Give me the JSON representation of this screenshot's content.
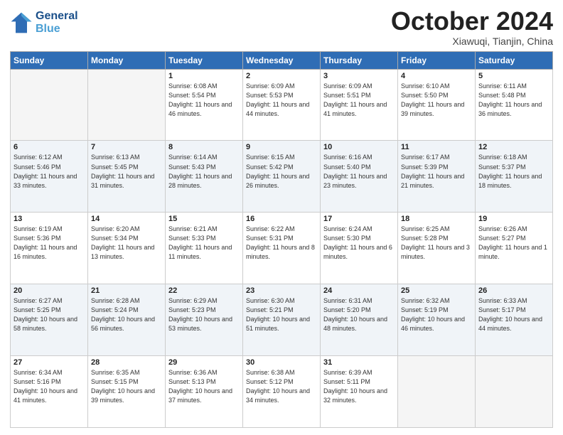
{
  "header": {
    "logo_line1": "General",
    "logo_line2": "Blue",
    "month": "October 2024",
    "location": "Xiawuqi, Tianjin, China"
  },
  "weekdays": [
    "Sunday",
    "Monday",
    "Tuesday",
    "Wednesday",
    "Thursday",
    "Friday",
    "Saturday"
  ],
  "weeks": [
    [
      {
        "day": "",
        "info": ""
      },
      {
        "day": "",
        "info": ""
      },
      {
        "day": "1",
        "info": "Sunrise: 6:08 AM\nSunset: 5:54 PM\nDaylight: 11 hours and 46 minutes."
      },
      {
        "day": "2",
        "info": "Sunrise: 6:09 AM\nSunset: 5:53 PM\nDaylight: 11 hours and 44 minutes."
      },
      {
        "day": "3",
        "info": "Sunrise: 6:09 AM\nSunset: 5:51 PM\nDaylight: 11 hours and 41 minutes."
      },
      {
        "day": "4",
        "info": "Sunrise: 6:10 AM\nSunset: 5:50 PM\nDaylight: 11 hours and 39 minutes."
      },
      {
        "day": "5",
        "info": "Sunrise: 6:11 AM\nSunset: 5:48 PM\nDaylight: 11 hours and 36 minutes."
      }
    ],
    [
      {
        "day": "6",
        "info": "Sunrise: 6:12 AM\nSunset: 5:46 PM\nDaylight: 11 hours and 33 minutes."
      },
      {
        "day": "7",
        "info": "Sunrise: 6:13 AM\nSunset: 5:45 PM\nDaylight: 11 hours and 31 minutes."
      },
      {
        "day": "8",
        "info": "Sunrise: 6:14 AM\nSunset: 5:43 PM\nDaylight: 11 hours and 28 minutes."
      },
      {
        "day": "9",
        "info": "Sunrise: 6:15 AM\nSunset: 5:42 PM\nDaylight: 11 hours and 26 minutes."
      },
      {
        "day": "10",
        "info": "Sunrise: 6:16 AM\nSunset: 5:40 PM\nDaylight: 11 hours and 23 minutes."
      },
      {
        "day": "11",
        "info": "Sunrise: 6:17 AM\nSunset: 5:39 PM\nDaylight: 11 hours and 21 minutes."
      },
      {
        "day": "12",
        "info": "Sunrise: 6:18 AM\nSunset: 5:37 PM\nDaylight: 11 hours and 18 minutes."
      }
    ],
    [
      {
        "day": "13",
        "info": "Sunrise: 6:19 AM\nSunset: 5:36 PM\nDaylight: 11 hours and 16 minutes."
      },
      {
        "day": "14",
        "info": "Sunrise: 6:20 AM\nSunset: 5:34 PM\nDaylight: 11 hours and 13 minutes."
      },
      {
        "day": "15",
        "info": "Sunrise: 6:21 AM\nSunset: 5:33 PM\nDaylight: 11 hours and 11 minutes."
      },
      {
        "day": "16",
        "info": "Sunrise: 6:22 AM\nSunset: 5:31 PM\nDaylight: 11 hours and 8 minutes."
      },
      {
        "day": "17",
        "info": "Sunrise: 6:24 AM\nSunset: 5:30 PM\nDaylight: 11 hours and 6 minutes."
      },
      {
        "day": "18",
        "info": "Sunrise: 6:25 AM\nSunset: 5:28 PM\nDaylight: 11 hours and 3 minutes."
      },
      {
        "day": "19",
        "info": "Sunrise: 6:26 AM\nSunset: 5:27 PM\nDaylight: 11 hours and 1 minute."
      }
    ],
    [
      {
        "day": "20",
        "info": "Sunrise: 6:27 AM\nSunset: 5:25 PM\nDaylight: 10 hours and 58 minutes."
      },
      {
        "day": "21",
        "info": "Sunrise: 6:28 AM\nSunset: 5:24 PM\nDaylight: 10 hours and 56 minutes."
      },
      {
        "day": "22",
        "info": "Sunrise: 6:29 AM\nSunset: 5:23 PM\nDaylight: 10 hours and 53 minutes."
      },
      {
        "day": "23",
        "info": "Sunrise: 6:30 AM\nSunset: 5:21 PM\nDaylight: 10 hours and 51 minutes."
      },
      {
        "day": "24",
        "info": "Sunrise: 6:31 AM\nSunset: 5:20 PM\nDaylight: 10 hours and 48 minutes."
      },
      {
        "day": "25",
        "info": "Sunrise: 6:32 AM\nSunset: 5:19 PM\nDaylight: 10 hours and 46 minutes."
      },
      {
        "day": "26",
        "info": "Sunrise: 6:33 AM\nSunset: 5:17 PM\nDaylight: 10 hours and 44 minutes."
      }
    ],
    [
      {
        "day": "27",
        "info": "Sunrise: 6:34 AM\nSunset: 5:16 PM\nDaylight: 10 hours and 41 minutes."
      },
      {
        "day": "28",
        "info": "Sunrise: 6:35 AM\nSunset: 5:15 PM\nDaylight: 10 hours and 39 minutes."
      },
      {
        "day": "29",
        "info": "Sunrise: 6:36 AM\nSunset: 5:13 PM\nDaylight: 10 hours and 37 minutes."
      },
      {
        "day": "30",
        "info": "Sunrise: 6:38 AM\nSunset: 5:12 PM\nDaylight: 10 hours and 34 minutes."
      },
      {
        "day": "31",
        "info": "Sunrise: 6:39 AM\nSunset: 5:11 PM\nDaylight: 10 hours and 32 minutes."
      },
      {
        "day": "",
        "info": ""
      },
      {
        "day": "",
        "info": ""
      }
    ]
  ]
}
